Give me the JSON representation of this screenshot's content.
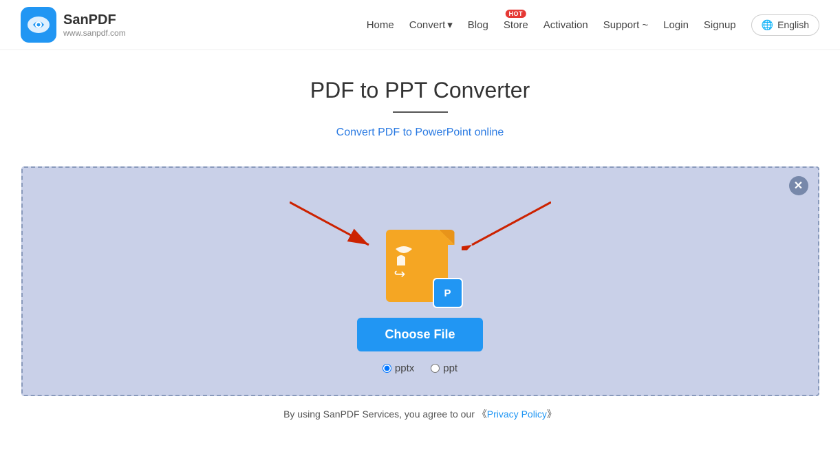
{
  "header": {
    "logo_title": "SanPDF",
    "logo_sub": "www.sanpdf.com",
    "nav": {
      "home": "Home",
      "convert": "Convert",
      "convert_chevron": "▾",
      "blog": "Blog",
      "store": "Store",
      "store_badge": "HOT",
      "activation": "Activation",
      "support": "Support",
      "support_chevron": "~",
      "login": "Login",
      "signup": "Signup",
      "lang_icon": "🌐",
      "lang": "English"
    }
  },
  "main": {
    "page_title": "PDF to PPT Converter",
    "page_subtitle": "Convert PDF to PowerPoint online",
    "drop_zone": {
      "choose_file_btn": "Choose File",
      "radio_opt1": "pptx",
      "radio_opt2": "ppt",
      "close_icon": "✕"
    },
    "footer_note_prefix": "By using SanPDF Services, you agree to our  《",
    "footer_note_link": "Privacy Policy",
    "footer_note_suffix": "》"
  }
}
